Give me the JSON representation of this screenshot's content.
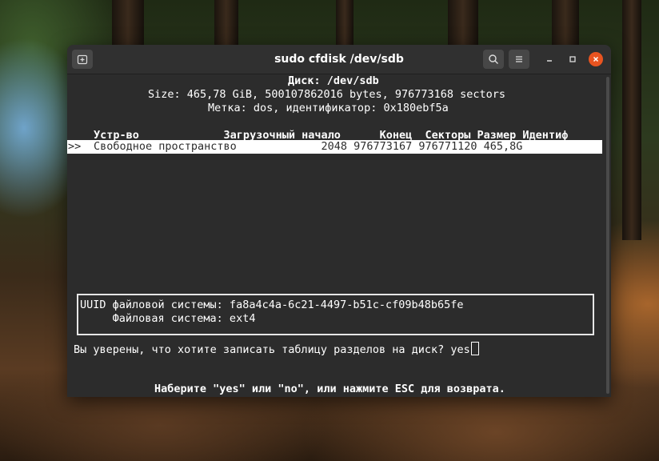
{
  "window": {
    "title": "sudo cfdisk /dev/sdb"
  },
  "terminal": {
    "disk_line": "Диск: /dev/sdb",
    "size_line": "Size: 465,78 GiB, 500107862016 bytes, 976773168 sectors",
    "label_line": "Метка: dos, идентификатор: 0x180ebf5a",
    "table_header": "Устр-во             Загрузочный начало      Конец  Секторы Размер Идентиф",
    "row": {
      "marker": ">>",
      "text": "Свободное пространство             2048 976773167 976771120 465,8G"
    },
    "info": {
      "uuid_line": "UUID файловой системы: fa8a4c4a-6c21-4497-b51c-cf09b48b65fe",
      "fs_line": "     Файловая система: ext4"
    },
    "prompt": "Вы уверены, что хотите записать таблицу разделов на диск? yes",
    "hint": "Наберите \"yes\" или \"no\", или нажмите ESC для возврата."
  }
}
